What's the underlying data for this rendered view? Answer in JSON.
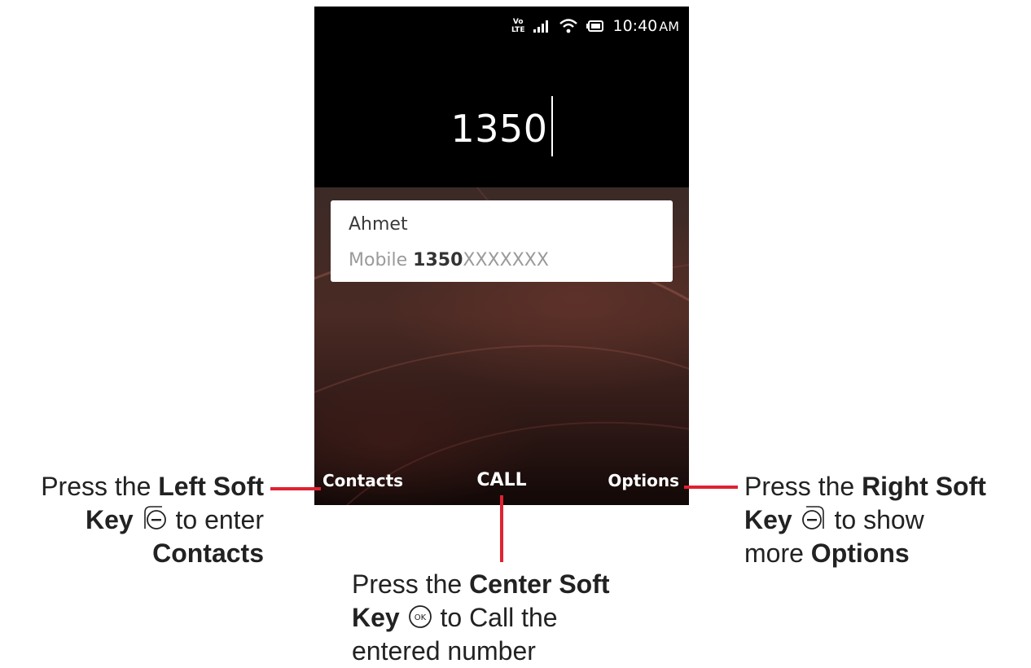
{
  "status_bar": {
    "volte_top": "Vo",
    "volte_bottom": "LTE",
    "time": "10:40",
    "ampm": "AM",
    "icons": [
      "volte-icon",
      "signal-icon",
      "wifi-icon",
      "battery-icon"
    ]
  },
  "dialer": {
    "number": "1350"
  },
  "suggestion": {
    "name": "Ahmet",
    "label": "Mobile",
    "number_match": "1350",
    "number_rest": "XXXXXXX"
  },
  "softkeys": {
    "left": "Contacts",
    "center": "CALL",
    "right": "Options"
  },
  "callouts": {
    "left": {
      "line1_pre": "Press the ",
      "line1_bold": "Left Soft",
      "line2_bold": "Key",
      "line2_post": " to enter",
      "line3_bold": "Contacts"
    },
    "center": {
      "line1_pre": "Press the ",
      "line1_bold": "Center Soft",
      "line2_bold": "Key",
      "line2_post": " to Call the",
      "line3": "entered number"
    },
    "right": {
      "line1_pre": "Press the ",
      "line1_bold": "Right Soft",
      "line2_bold": "Key",
      "line2_post": " to show",
      "line3_pre": "more ",
      "line3_bold": "Options"
    }
  },
  "colors": {
    "accent_line": "#e02233",
    "screen_black": "#000000",
    "card_white": "#ffffff"
  },
  "center_key_glyph": "OK"
}
